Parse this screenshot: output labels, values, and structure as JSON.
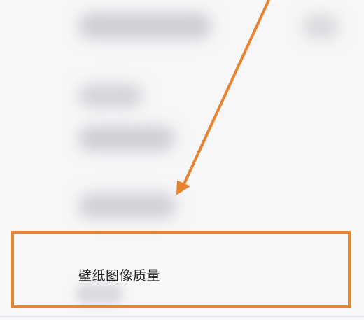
{
  "settings_item": {
    "label": "壁纸图像质量"
  },
  "annotation": {
    "color": "#e8842f"
  }
}
